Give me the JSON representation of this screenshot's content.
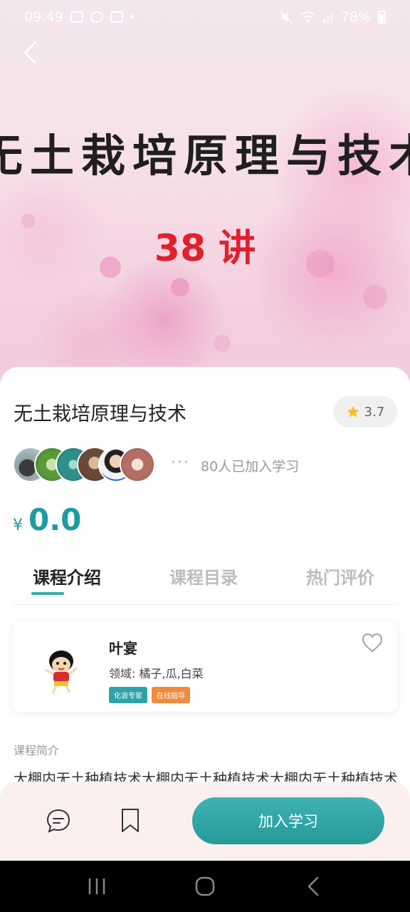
{
  "status_bar": {
    "time": "09:49",
    "battery": "78%"
  },
  "banner": {
    "title": "无土栽培原理与技术",
    "subtitle": "38 讲"
  },
  "course": {
    "title": "无土栽培原理与技术",
    "rating": "3.7",
    "learners_text": "80人已加入学习",
    "more_dots": "···",
    "currency": "¥",
    "price": "0.0"
  },
  "tabs": [
    {
      "label": "课程介绍"
    },
    {
      "label": "课程目录"
    },
    {
      "label": "热门评价"
    }
  ],
  "teacher": {
    "name": "叶宴",
    "field": "领域: 橘子,瓜,白菜",
    "badges": [
      "化浪专家",
      "在线指导"
    ]
  },
  "intro": {
    "label": "课程简介",
    "text": "大棚内无土种植技术大棚内无土种植技术大棚内无土种植技术"
  },
  "actions": {
    "join_label": "加入学习"
  },
  "colors": {
    "accent": "#1e9aa0",
    "tab_indicator": "#35b0ad",
    "badge_expert": "#2fa3a6",
    "badge_online": "#f08a3c",
    "action_bar_bg": "#fcf0ef"
  }
}
